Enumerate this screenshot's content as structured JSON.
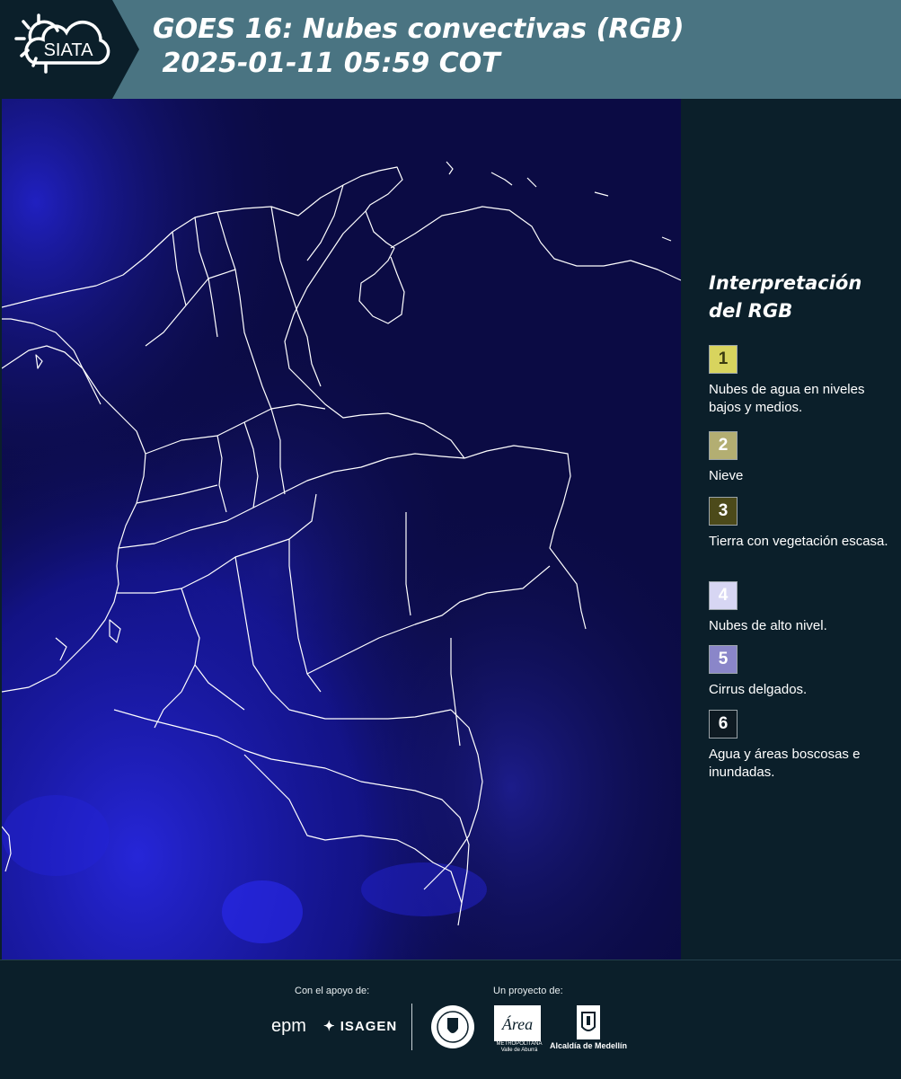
{
  "header": {
    "logo_text": "SIATA",
    "title": "GOES 16: Nubes convectivas (RGB)\n 2025-01-11 05:59 COT"
  },
  "legend": {
    "title": "Interpretación del RGB",
    "items": [
      {
        "number": "1",
        "label": "Nubes de agua en niveles bajos y medios.",
        "color": "#d8d45e",
        "text_color": "#3a3a10"
      },
      {
        "number": "2",
        "label": "Nieve",
        "color": "#b3ae72",
        "text_color": "#ffffff"
      },
      {
        "number": "3",
        "label": "Tierra con vegetación escasa.",
        "color": "#4c4a1a",
        "text_color": "#ffffff"
      },
      {
        "number": "4",
        "label": "Nubes de alto nivel.",
        "color": "#d7d6f3",
        "text_color": "#ffffff"
      },
      {
        "number": "5",
        "label": "Cirrus delgados.",
        "color": "#8a86c9",
        "text_color": "#ffffff"
      },
      {
        "number": "6",
        "label": "Agua y áreas boscosas e inundadas.",
        "color": "#0e1a22",
        "text_color": "#ffffff"
      }
    ]
  },
  "footer": {
    "support_label": "Con el apoyo de:",
    "project_label": "Un proyecto de:",
    "sponsor_epm": "epm",
    "sponsor_isagen": "ISAGEN",
    "partner_area": "Área",
    "partner_area_sub": "METROPOLITANA Valle de Aburrá",
    "partner_alcaldia": "Alcaldía de Medellín"
  },
  "colors": {
    "header_bg": "#4a7482",
    "page_bg": "#0b1f2a",
    "map_bg": "#0b0b44",
    "border_line": "#ffffff"
  }
}
